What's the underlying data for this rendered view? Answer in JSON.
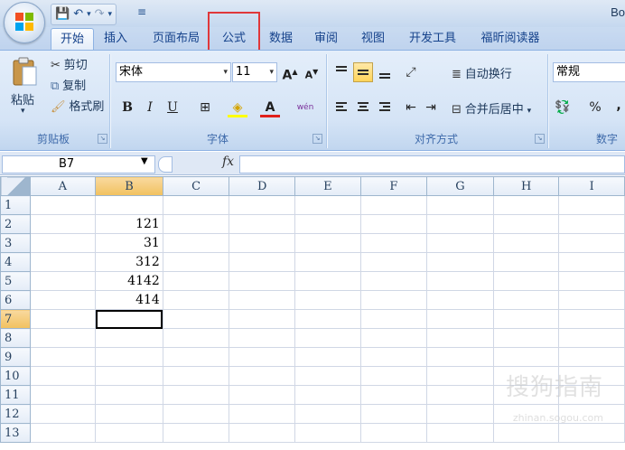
{
  "app": {
    "title": "Bo"
  },
  "quick_access": {
    "save": "💾",
    "undo": "↶",
    "undo_dd": "▾",
    "redo": "↷",
    "redo_dd": "▾",
    "more": "≡"
  },
  "tabs": [
    {
      "label": "开始",
      "active": true
    },
    {
      "label": "插入"
    },
    {
      "label": "页面布局"
    },
    {
      "label": "公式",
      "highlighted": true
    },
    {
      "label": "数据"
    },
    {
      "label": "审阅"
    },
    {
      "label": "视图"
    },
    {
      "label": "开发工具"
    },
    {
      "label": "福昕阅读器"
    }
  ],
  "ribbon": {
    "clipboard": {
      "paste": "粘贴",
      "cut": "剪切",
      "copy": "复制",
      "format_painter": "格式刷",
      "group_label": "剪贴板"
    },
    "font": {
      "font_name": "宋体",
      "font_size": "11",
      "grow": "A",
      "shrink": "A",
      "bold": "B",
      "italic": "I",
      "underline": "U",
      "border": "⊞",
      "fill_color": "◈",
      "font_color": "A",
      "phonetic": "wén",
      "group_label": "字体"
    },
    "alignment": {
      "wrap": "自动换行",
      "merge": "合并后居中",
      "group_label": "对齐方式"
    },
    "number": {
      "format": "常规",
      "percent": "%",
      "comma": ",",
      "group_label": "数字"
    }
  },
  "formula_bar": {
    "name_box": "B7",
    "fx": "fx"
  },
  "grid": {
    "columns": [
      "A",
      "B",
      "C",
      "D",
      "E",
      "F",
      "G",
      "H",
      "I"
    ],
    "selected_column": "B",
    "selected_row": 7,
    "rows": [
      {
        "n": "1",
        "b": ""
      },
      {
        "n": "2",
        "b": "121"
      },
      {
        "n": "3",
        "b": "31"
      },
      {
        "n": "4",
        "b": "312"
      },
      {
        "n": "5",
        "b": "4142"
      },
      {
        "n": "6",
        "b": "414"
      },
      {
        "n": "7",
        "b": ""
      },
      {
        "n": "8",
        "b": ""
      },
      {
        "n": "9",
        "b": ""
      },
      {
        "n": "10",
        "b": ""
      },
      {
        "n": "11",
        "b": ""
      },
      {
        "n": "12",
        "b": ""
      },
      {
        "n": "13",
        "b": ""
      }
    ]
  },
  "watermark": {
    "main": "搜狗指南",
    "sub": "zhinan.sogou.com"
  },
  "colors": {
    "ribbon_bg": "#d5e4f6",
    "tab_text": "#15428b",
    "highlight_box": "#e0373a",
    "selected_header": "#f1c15f"
  }
}
